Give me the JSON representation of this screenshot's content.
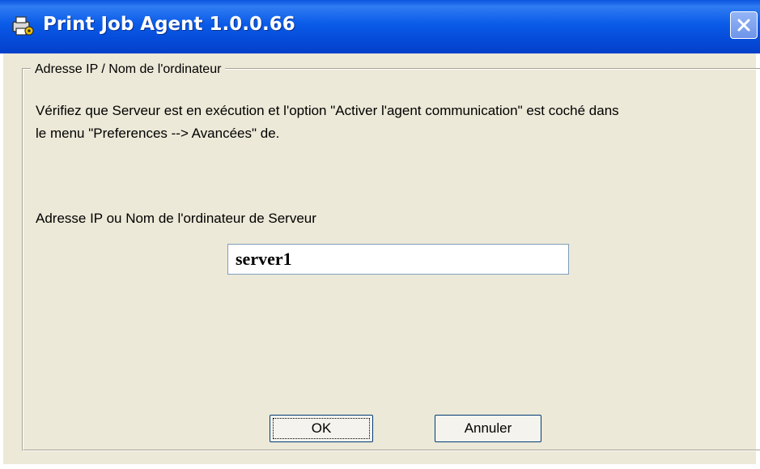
{
  "window": {
    "title": "Print Job Agent 1.0.0.66",
    "icon": "print-agent-icon",
    "close_icon": "close-icon",
    "titlebar_color": "#0a5be8",
    "background_color": "#ece9d8"
  },
  "group": {
    "legend": "Adresse IP / Nom de l'ordinateur"
  },
  "info": {
    "line1": "Vérifiez que Serveur est en exécution et l'option \"Activer l'agent communication\" est coché dans",
    "line2": "le menu \"Preferences --> Avancées\" de."
  },
  "server": {
    "label": "Adresse IP ou Nom de l'ordinateur de Serveur",
    "value": "server1"
  },
  "buttons": {
    "ok": "OK",
    "cancel": "Annuler"
  }
}
